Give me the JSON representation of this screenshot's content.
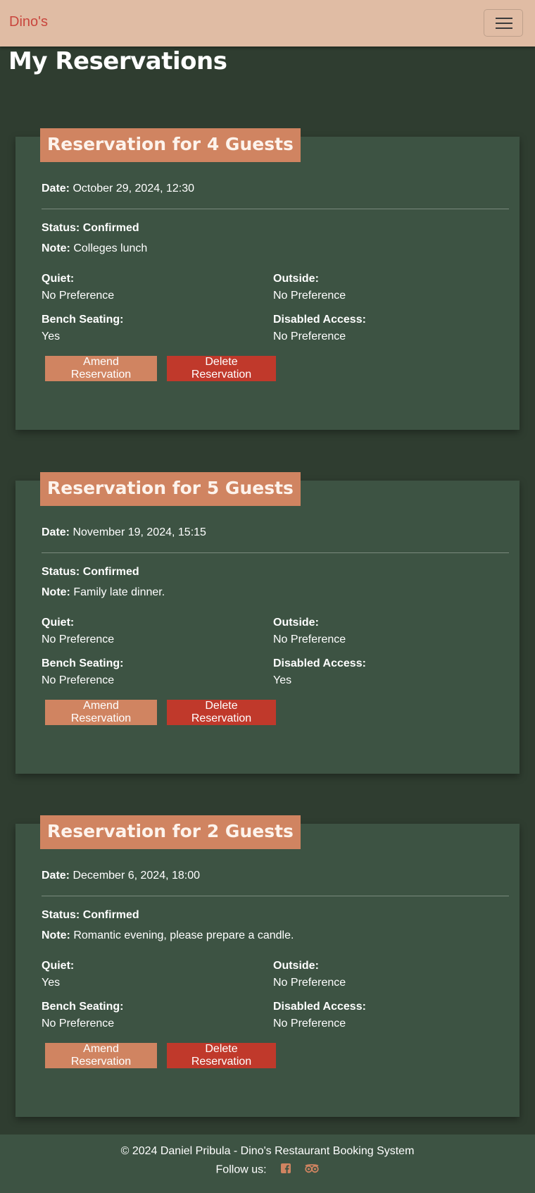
{
  "navbar": {
    "brand": "Dino's",
    "toggle_icon": "hamburger-menu-icon"
  },
  "page": {
    "title": "My Reservations"
  },
  "labels": {
    "date": "Date:",
    "status": "Status:",
    "note": "Note:",
    "quiet": "Quiet:",
    "outside": "Outside:",
    "bench": "Bench Seating:",
    "disabled": "Disabled Access:",
    "amend": "Amend Reservation",
    "delete": "Delete Reservation"
  },
  "reservations": [
    {
      "title": "Reservation for 4 Guests",
      "date": "October 29, 2024, 12:30",
      "status": "Confirmed",
      "note": "Colleges lunch",
      "quiet": "No Preference",
      "outside": "No Preference",
      "bench": "Yes",
      "disabled": "No Preference"
    },
    {
      "title": "Reservation for 5 Guests",
      "date": "November 19, 2024, 15:15",
      "status": "Confirmed",
      "note": "Family late dinner.",
      "quiet": "No Preference",
      "outside": "No Preference",
      "bench": "No Preference",
      "disabled": "Yes"
    },
    {
      "title": "Reservation for 2 Guests",
      "date": "December 6, 2024, 18:00",
      "status": "Confirmed",
      "note": "Romantic evening, please prepare a candle.",
      "quiet": "Yes",
      "outside": "No Preference",
      "bench": "No Preference",
      "disabled": "No Preference"
    }
  ],
  "footer": {
    "copyright": "© 2024 Daniel Pribula - Dino's Restaurant Booking System",
    "follow": "Follow us:",
    "social_icons": [
      "facebook-icon",
      "tripadvisor-icon"
    ]
  },
  "colors": {
    "background": "#2f3d30",
    "card": "#3d5343",
    "navbar": "#e0bca4",
    "brand": "#c9463d",
    "accent": "#d08461",
    "danger": "#c0392b"
  }
}
